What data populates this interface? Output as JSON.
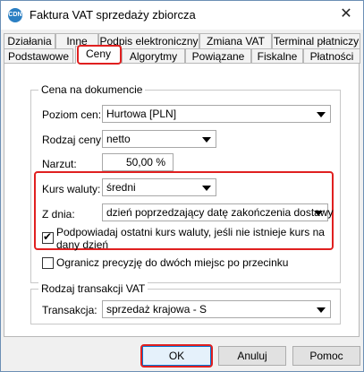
{
  "window": {
    "title": "Faktura VAT sprzedaży zbiorcza",
    "icon_label": "CDN",
    "close_glyph": "✕"
  },
  "tabs_row1": [
    "Działania",
    "Inne",
    "Podpis elektroniczny",
    "Zmiana VAT",
    "Terminal płatniczy"
  ],
  "tabs_row2": [
    "Podstawowe",
    "Ceny",
    "Algorytmy",
    "Powiązane",
    "Fiskalne",
    "Płatności"
  ],
  "active_tab": "Ceny",
  "cena_group": {
    "title": "Cena na dokumencie",
    "poziom_cen_label": "Poziom cen:",
    "poziom_cen_value": "Hurtowa [PLN]",
    "rodzaj_ceny_label": "Rodzaj ceny:",
    "rodzaj_ceny_value": "netto",
    "narzut_label": "Narzut:",
    "narzut_value": "50,00 %",
    "kurs_label": "Kurs waluty:",
    "kurs_value": "średni",
    "z_dnia_label": "Z dnia:",
    "z_dnia_value": "dzień poprzedzający datę zakończenia dostawy",
    "podpowiadaj_line1": "Podpowiadaj ostatni kurs waluty, jeśli nie istnieje kurs na",
    "podpowiadaj_line2": "dany dzień",
    "podpowiadaj_checked": true
  },
  "ogranicz": {
    "label": "Ogranicz precyzję do dwóch miejsc po przecinku",
    "checked": false
  },
  "transakcja_group": {
    "title": "Rodzaj transakcji VAT",
    "label": "Transakcja:",
    "value": "sprzedaż krajowa - S"
  },
  "buttons": {
    "ok": "OK",
    "cancel": "Anuluj",
    "help": "Pomoc"
  },
  "colors": {
    "highlight": "#e02020",
    "accent": "#0078d7"
  }
}
